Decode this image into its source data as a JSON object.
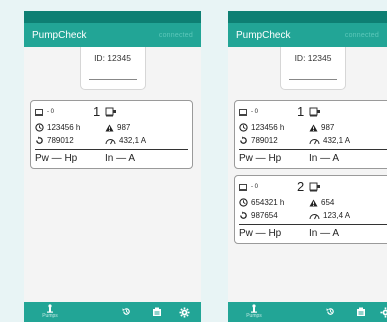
{
  "app": {
    "title": "PumpCheck",
    "connection_status": "connected"
  },
  "device": {
    "id_label": "ID: 12345"
  },
  "pumps": [
    {
      "index_label": "1",
      "small_value": "- 0",
      "runtime": "123456 h",
      "alarms": "987",
      "cycles": "789012",
      "current": "432,1 A",
      "power": "Pw — Hp",
      "in_current": "In — A"
    },
    {
      "index_label": "2",
      "small_value": "- 0",
      "runtime": "654321 h",
      "alarms": "654",
      "cycles": "987654",
      "current": "123,4 A",
      "power": "Pw — Hp",
      "in_current": "In — A"
    }
  ],
  "nav": {
    "pumps_label": "Pumps"
  },
  "icons": [
    "pump-icon",
    "clock-icon",
    "warning-icon",
    "cycle-icon",
    "current-icon",
    "history-icon",
    "report-icon",
    "gear-icon"
  ],
  "colors": {
    "primary": "#22a596",
    "status_bar": "#0e7f73",
    "background": "#e8f4f5"
  }
}
